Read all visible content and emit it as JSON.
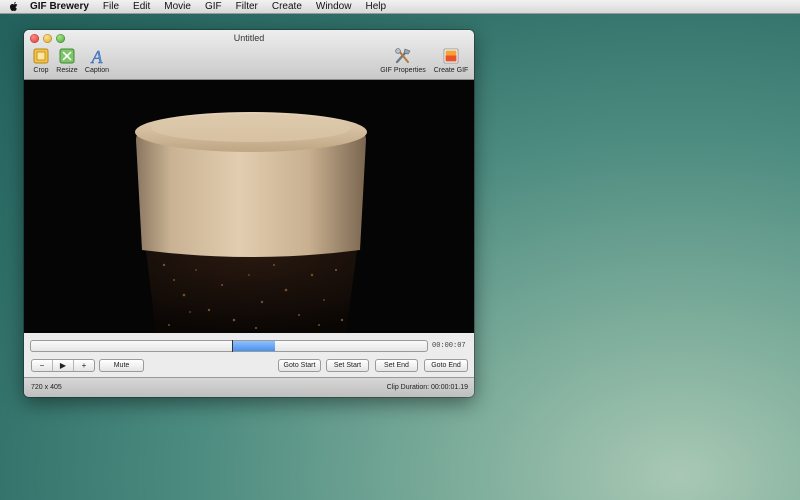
{
  "menubar": {
    "app_name": "GIF Brewery",
    "items": [
      "File",
      "Edit",
      "Movie",
      "GIF",
      "Filter",
      "Create",
      "Window",
      "Help"
    ]
  },
  "window": {
    "title": "Untitled",
    "toolbar": {
      "crop_label": "Crop",
      "resize_label": "Resize",
      "caption_label": "Caption",
      "gif_properties_label": "GIF Properties",
      "create_gif_label": "Create GIF"
    },
    "timeline": {
      "timecode": "00:00:07",
      "playhead_fraction": 0.508,
      "selection_start_fraction": 0.508,
      "selection_end_fraction": 0.615
    },
    "controls": {
      "minus_label": "−",
      "play_label": "▶",
      "plus_label": "+",
      "mute_label": "Mute",
      "goto_start_label": "Goto Start",
      "set_start_label": "Set Start",
      "set_end_label": "Set End",
      "goto_end_label": "Goto End"
    },
    "status": {
      "dimensions": "720 x 405",
      "clip_duration": "Clip Duration: 00:00:01.19"
    }
  },
  "colors": {
    "selection": "#4a91ec",
    "desktop": "#2f6f68"
  }
}
